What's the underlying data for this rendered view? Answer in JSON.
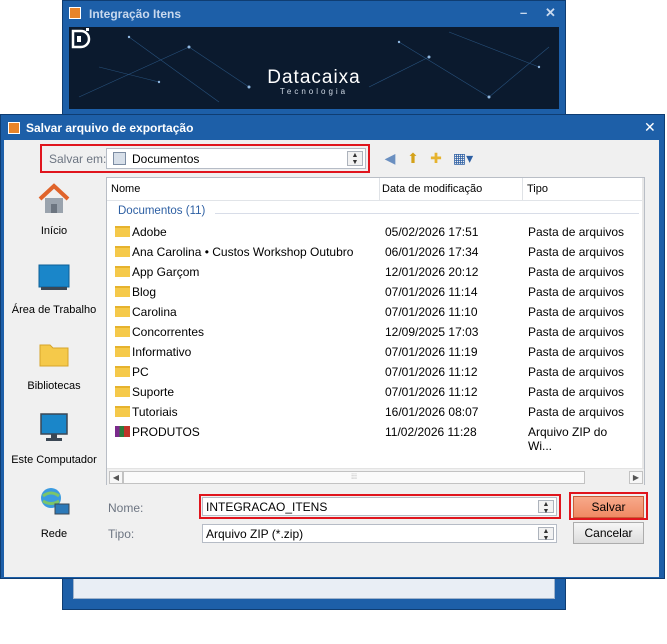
{
  "background_window": {
    "title": "Integração Itens",
    "minimize_label": "–",
    "close_label": "✕",
    "brand_name": "Datacaixa",
    "brand_tagline": "Tecnologia"
  },
  "dialog": {
    "title": "Salvar arquivo de exportação",
    "close_label": "✕",
    "save_in_label": "Salvar em:",
    "save_in_value": "Documentos",
    "toolbar_icons": [
      "back-icon",
      "up-folder-icon",
      "new-folder-icon",
      "view-menu-icon"
    ],
    "places": [
      {
        "label": "Início",
        "icon": "home-icon"
      },
      {
        "label": "Área de Trabalho",
        "icon": "desktop-icon"
      },
      {
        "label": "Bibliotecas",
        "icon": "libraries-icon"
      },
      {
        "label": "Este Computador",
        "icon": "computer-icon"
      },
      {
        "label": "Rede",
        "icon": "network-icon"
      }
    ],
    "columns": {
      "name": "Nome",
      "date": "Data de modificação",
      "type": "Tipo"
    },
    "group_header": "Documentos (11)",
    "files": [
      {
        "name": "Adobe",
        "date": "05/02/2026 17:51",
        "type": "Pasta de arquivos",
        "icon": "folder-icon"
      },
      {
        "name": "Ana Carolina • Custos Workshop Outubro",
        "date": "06/01/2026 17:34",
        "type": "Pasta de arquivos",
        "icon": "folder-icon"
      },
      {
        "name": "App Garçom",
        "date": "12/01/2026 20:12",
        "type": "Pasta de arquivos",
        "icon": "folder-icon"
      },
      {
        "name": "Blog",
        "date": "07/01/2026 11:14",
        "type": "Pasta de arquivos",
        "icon": "folder-icon"
      },
      {
        "name": "Carolina",
        "date": "07/01/2026 11:10",
        "type": "Pasta de arquivos",
        "icon": "folder-icon"
      },
      {
        "name": "Concorrentes",
        "date": "12/09/2025 17:03",
        "type": "Pasta de arquivos",
        "icon": "folder-icon"
      },
      {
        "name": "Informativo",
        "date": "07/01/2026 11:19",
        "type": "Pasta de arquivos",
        "icon": "folder-icon"
      },
      {
        "name": "PC",
        "date": "07/01/2026 11:12",
        "type": "Pasta de arquivos",
        "icon": "folder-icon"
      },
      {
        "name": "Suporte",
        "date": "07/01/2026 11:12",
        "type": "Pasta de arquivos",
        "icon": "folder-icon"
      },
      {
        "name": "Tutoriais",
        "date": "16/01/2026 08:07",
        "type": "Pasta de arquivos",
        "icon": "folder-icon"
      },
      {
        "name": "PRODUTOS",
        "date": "11/02/2026 11:28",
        "type": "Arquivo ZIP do Wi...",
        "icon": "zip-icon"
      }
    ],
    "filename_label": "Nome:",
    "filename_value": "INTEGRACAO_ITENS",
    "filetype_label": "Tipo:",
    "filetype_value": "Arquivo ZIP (*.zip)",
    "save_button": "Salvar",
    "cancel_button": "Cancelar"
  },
  "colors": {
    "titlebar": "#1d5fa8",
    "highlight": "#e0151d",
    "save_button": "#f08a64",
    "group_header": "#2d5fa3"
  }
}
